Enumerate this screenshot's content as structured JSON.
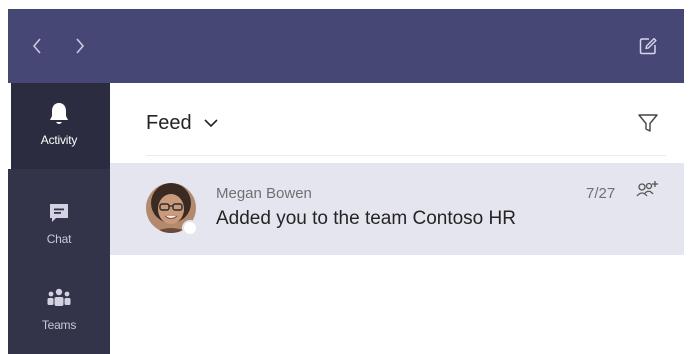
{
  "rail": {
    "items": [
      {
        "label": "Activity",
        "icon": "bell-icon",
        "active": true
      },
      {
        "label": "Chat",
        "icon": "chat-icon",
        "active": false
      },
      {
        "label": "Teams",
        "icon": "teams-icon",
        "active": false
      }
    ]
  },
  "feed": {
    "filter_label": "Feed"
  },
  "activity": [
    {
      "sender": "Megan Bowen",
      "message": "Added you to the team Contoso HR",
      "time": "7/27",
      "type_icon": "add-people-icon"
    }
  ],
  "colors": {
    "titlebar": "#464775",
    "rail": "#33344a",
    "row_highlight": "#e5e5f0"
  }
}
